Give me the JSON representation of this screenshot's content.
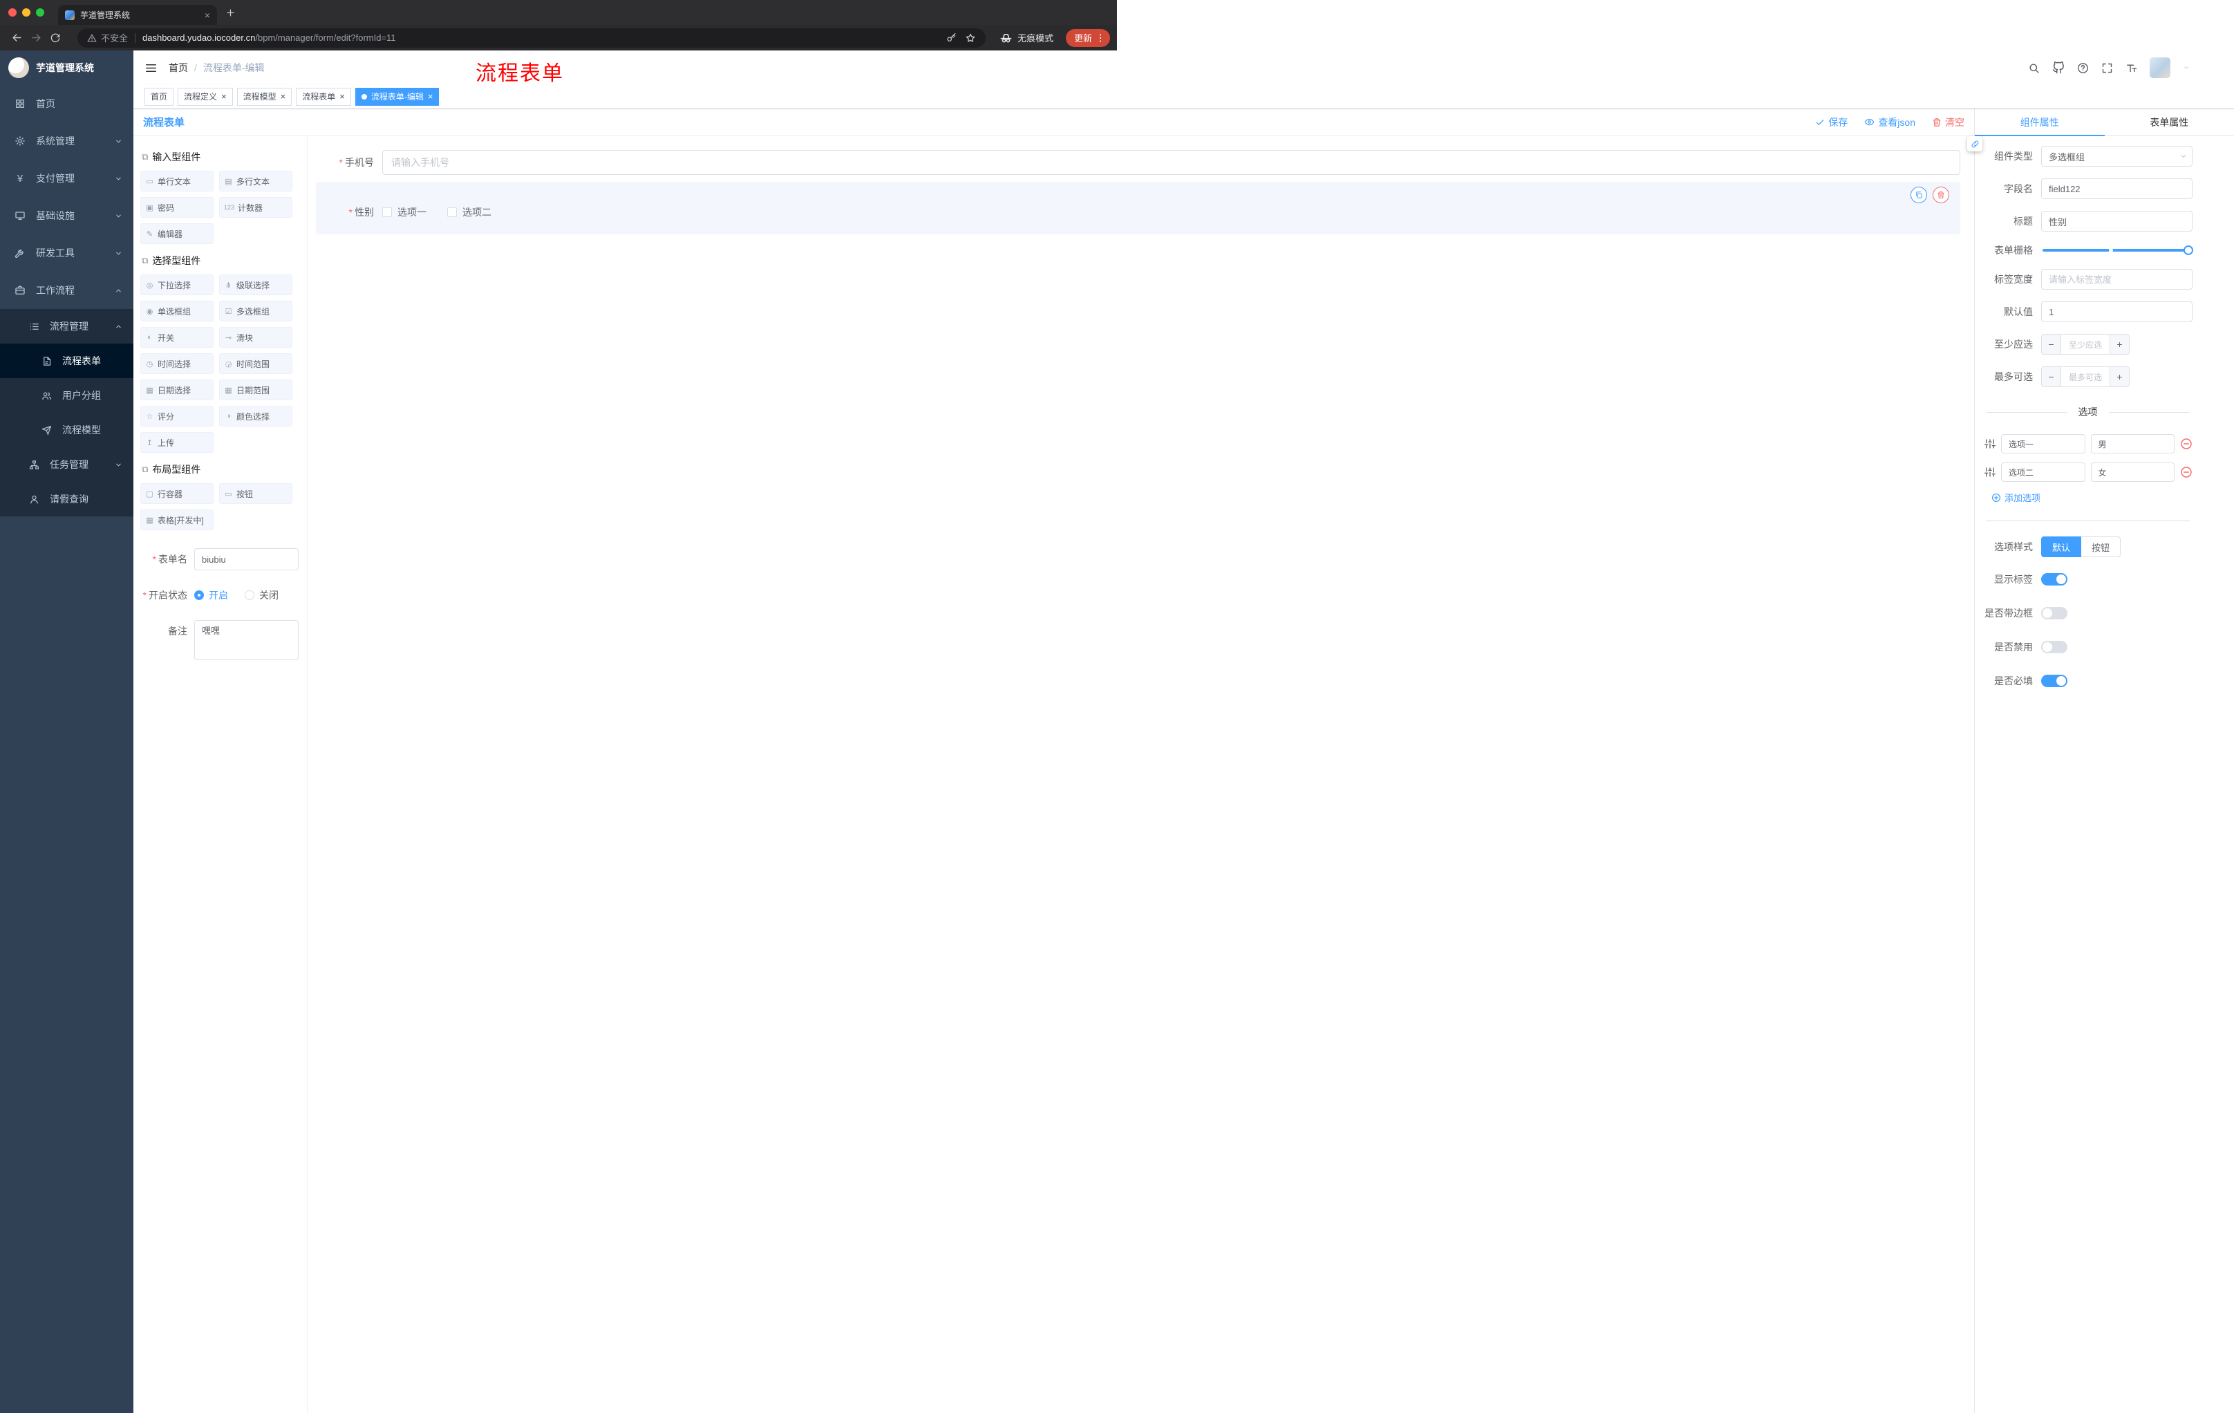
{
  "ui": {
    "required_mark": "*"
  },
  "glyphs": {
    "close": "×",
    "minus": "−",
    "plus": "+",
    "yen": "¥",
    "section": "⧉"
  },
  "colors": {
    "primary": "#409EFF",
    "danger": "#F56C6C",
    "annotation": "#FF0000",
    "sidebar": "#304156",
    "update_pill": "#D14836"
  },
  "browser": {
    "tab_title": "芋道管理系统",
    "security_label": "不安全",
    "url_domain": "dashboard.yudao.iocoder.cn",
    "url_path": "/bpm/manager/form/edit?formId=11",
    "incognito_label": "无痕模式",
    "update_label": "更新"
  },
  "sidebar": {
    "title": "芋道管理系统",
    "menu": [
      {
        "label": "首页"
      },
      {
        "label": "系统管理"
      },
      {
        "label": "支付管理"
      },
      {
        "label": "基础设施"
      },
      {
        "label": "研发工具"
      },
      {
        "label": "工作流程"
      },
      {
        "label": "流程管理"
      },
      {
        "label": "流程表单"
      },
      {
        "label": "用户分组"
      },
      {
        "label": "流程模型"
      },
      {
        "label": "任务管理"
      },
      {
        "label": "请假查询"
      }
    ]
  },
  "header": {
    "breadcrumb_home": "首页",
    "breadcrumb_sep": "/",
    "breadcrumb_current": "流程表单-编辑",
    "annotation": "流程表单"
  },
  "tags": [
    {
      "label": "首页"
    },
    {
      "label": "流程定义"
    },
    {
      "label": "流程模型"
    },
    {
      "label": "流程表单"
    },
    {
      "label": "流程表单-编辑"
    }
  ],
  "designer": {
    "title": "流程表单",
    "actions": {
      "save": "保存",
      "view_json": "查看json",
      "clear": "清空"
    },
    "sections": [
      {
        "title": "输入型组件",
        "items": [
          {
            "label": "单行文本",
            "glyph": "▭"
          },
          {
            "label": "多行文本",
            "glyph": "▤"
          },
          {
            "label": "密码",
            "glyph": "▣"
          },
          {
            "label": "计数器",
            "glyph": "123"
          },
          {
            "label": "编辑器",
            "glyph": "✎"
          }
        ]
      },
      {
        "title": "选择型组件",
        "items": [
          {
            "label": "下拉选择",
            "glyph": "◎"
          },
          {
            "label": "级联选择",
            "glyph": "⋔"
          },
          {
            "label": "单选框组",
            "glyph": "◉"
          },
          {
            "label": "多选框组",
            "glyph": "☑"
          },
          {
            "label": "开关",
            "glyph": "◐"
          },
          {
            "label": "滑块",
            "glyph": "⊸"
          },
          {
            "label": "时间选择",
            "glyph": "◷"
          },
          {
            "label": "时间范围",
            "glyph": "◶"
          },
          {
            "label": "日期选择",
            "glyph": "▦"
          },
          {
            "label": "日期范围",
            "glyph": "▦"
          },
          {
            "label": "评分",
            "glyph": "☆"
          },
          {
            "label": "颜色选择",
            "glyph": "◑"
          },
          {
            "label": "上传",
            "glyph": "↥"
          }
        ]
      },
      {
        "title": "布局型组件",
        "items": [
          {
            "label": "行容器",
            "glyph": "▢"
          },
          {
            "label": "按钮",
            "glyph": "▭"
          },
          {
            "label": "表格[开发中]",
            "glyph": "▦"
          }
        ]
      }
    ],
    "meta": {
      "name_label": "表单名",
      "name_value": "biubiu",
      "status_label": "开启状态",
      "status_on": "开启",
      "status_off": "关闭",
      "remark_label": "备注",
      "remark_value": "嘿嘿"
    }
  },
  "canvas": {
    "phone_label": "手机号",
    "phone_placeholder": "请输入手机号",
    "gender_label": "性别",
    "gender_options": [
      "选项一",
      "选项二"
    ]
  },
  "props": {
    "tab_component": "组件属性",
    "tab_form": "表单属性",
    "type_label": "组件类型",
    "type_value": "多选框组",
    "field_label": "字段名",
    "field_value": "field122",
    "title_label": "标题",
    "title_value": "性别",
    "grid_label": "表单栅格",
    "width_label": "标签宽度",
    "width_placeholder": "请输入标签宽度",
    "default_label": "默认值",
    "default_value": "1",
    "min_label": "至少应选",
    "min_placeholder": "至少应选",
    "max_label": "最多可选",
    "max_placeholder": "最多可选",
    "options_title": "选项",
    "options": [
      {
        "label": "选项一",
        "value": "男"
      },
      {
        "label": "选项二",
        "value": "女"
      }
    ],
    "add_option": "添加选项",
    "style_label": "选项样式",
    "style_default": "默认",
    "style_button": "按钮",
    "toggles": [
      {
        "label": "显示标签"
      },
      {
        "label": "是否带边框"
      },
      {
        "label": "是否禁用"
      },
      {
        "label": "是否必填"
      }
    ]
  }
}
